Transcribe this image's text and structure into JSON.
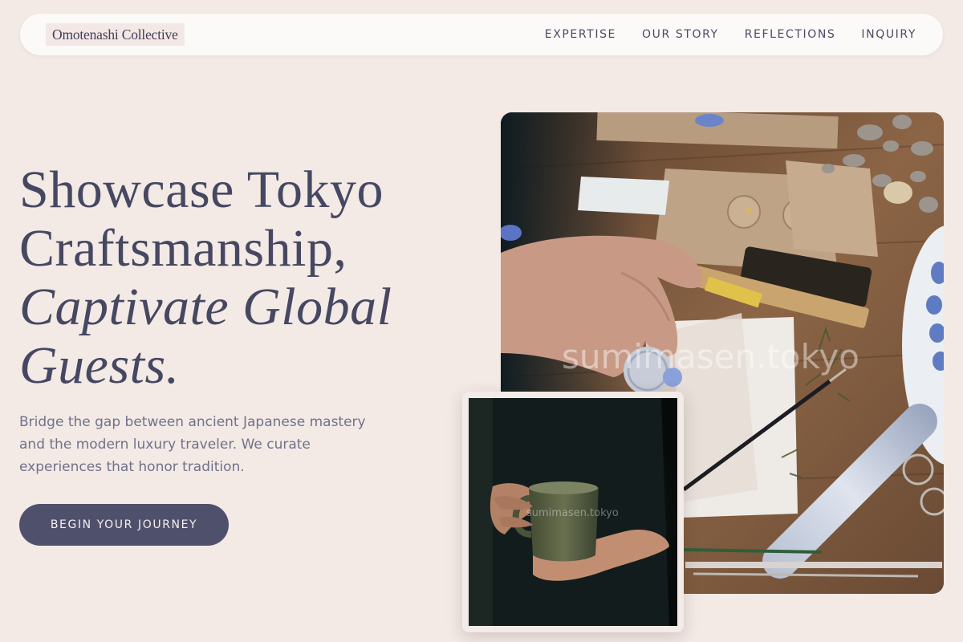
{
  "brand": {
    "name": "Omotenashi Collective"
  },
  "nav": {
    "items": [
      {
        "label": "EXPERTISE"
      },
      {
        "label": "OUR STORY"
      },
      {
        "label": "REFLECTIONS"
      },
      {
        "label": "INQUIRY"
      }
    ]
  },
  "hero": {
    "title_line1": "Showcase Tokyo",
    "title_line2": "Craftsmanship,",
    "title_line3": "Captivate Global",
    "title_line4": "Guests.",
    "description": "Bridge the gap between ancient Japanese mastery and the modern luxury traveler. We curate experiences that honor tradition.",
    "cta_label": "BEGIN YOUR JOURNEY"
  },
  "images": {
    "main_watermark": "sumimasen.tokyo",
    "overlay_watermark": "sumimasen.tokyo"
  },
  "colors": {
    "background": "#f3e9e5",
    "navbar": "#fcfaf8",
    "primary_text": "#464862",
    "button": "#4f506c",
    "muted_text": "#70728a"
  }
}
